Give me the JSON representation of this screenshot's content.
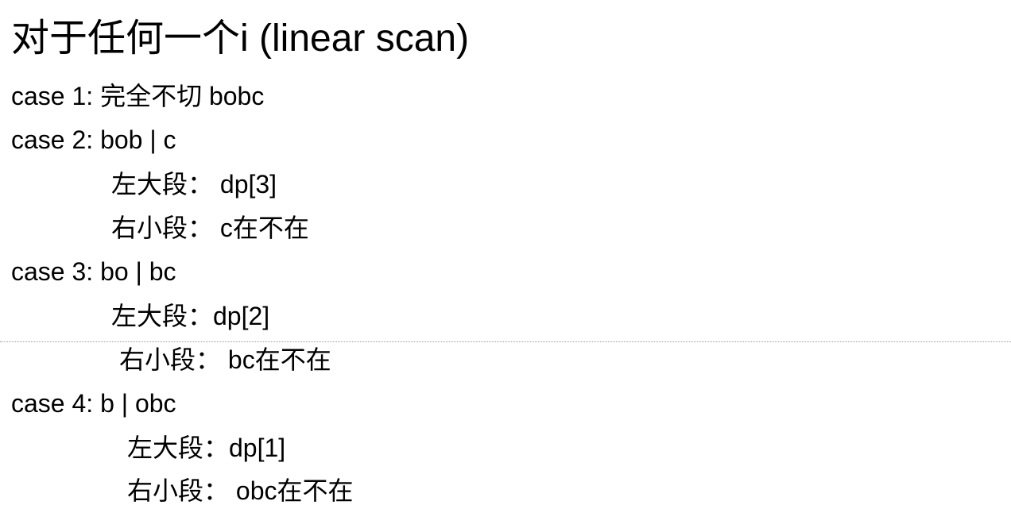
{
  "document": {
    "title": "对于任何一个i (linear scan)",
    "lines": [
      "case 1: 完全不切 bobc",
      "case 2:  bob | c",
      "左大段：  dp[3]",
      "右小段：  c在不在",
      "case 3:  bo | bc",
      "左大段：dp[2]",
      "右小段：  bc在不在",
      "case 4:  b | obc",
      "左大段：dp[1]",
      "右小段：  obc在不在"
    ]
  }
}
